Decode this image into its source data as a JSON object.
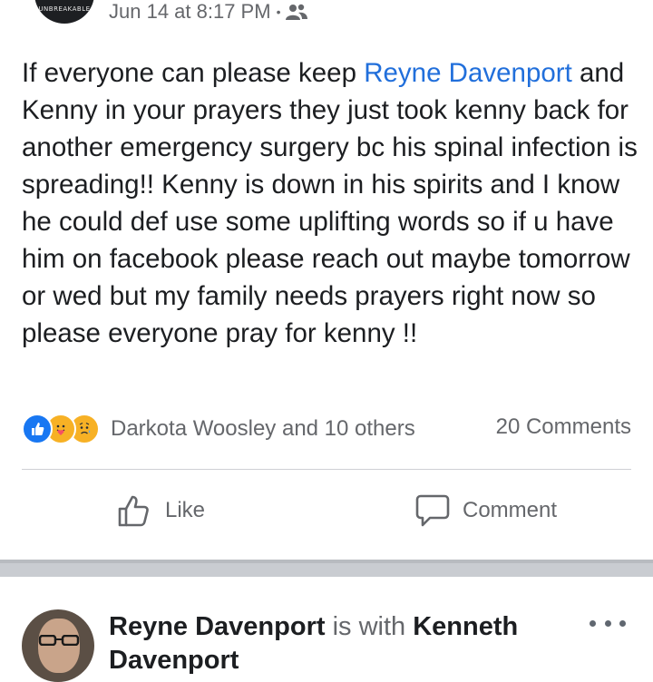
{
  "post": {
    "author_avatar_logo": "UNBREAKABLE",
    "timestamp": "Jun 14 at 8:17 PM",
    "privacy_icon": "friends-icon",
    "text_before_tag": "If everyone can please keep ",
    "tagged_name": "Reyne Davenport",
    "text_after_tag": " and Kenny in your prayers they just took kenny back for another emergency surgery bc his spinal infection is spreading!! Kenny is down in his spirits and I know he could def use some uplifting words so if u have him on facebook please reach out maybe tomorrow or wed but my family needs prayers right now so please everyone pray for kenny !!",
    "reactions": [
      "like-reaction-icon",
      "care-reaction-icon",
      "sad-reaction-icon"
    ],
    "reactors_text": "Darkota Woosley and 10 others",
    "comments_count": "20 Comments",
    "actions": {
      "like_label": "Like",
      "comment_label": "Comment"
    }
  },
  "next_post": {
    "author_name": "Reyne Davenport",
    "with_text": "is with",
    "with_name": "Kenneth",
    "with_name_cont": "Davenport"
  },
  "colors": {
    "link_blue": "#216fdb",
    "like_blue": "#1877f2",
    "secondary_text": "#65676b",
    "separator": "#c9ccd1"
  }
}
